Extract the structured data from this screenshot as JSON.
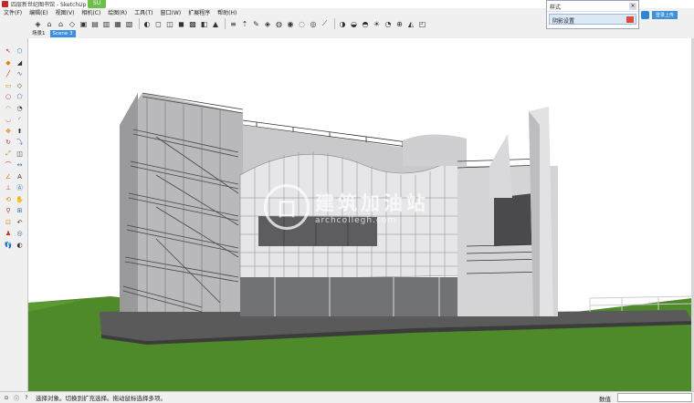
{
  "window": {
    "title": "四层新世纪图书馆 - SketchUp Make",
    "app_badge": "SU"
  },
  "menu": {
    "items": [
      "文件(F)",
      "编辑(E)",
      "视图(V)",
      "相机(C)",
      "绘图(R)",
      "工具(T)",
      "窗口(W)",
      "扩展程序",
      "帮助(H)"
    ]
  },
  "tray": {
    "title": "样式",
    "row_label": "阴影设置"
  },
  "account": {
    "label": "登录上传"
  },
  "scene_tabs": {
    "items": [
      "场景1",
      "Scene 3"
    ],
    "active_index": 1
  },
  "toolbar": {
    "icons": [
      "get-models-icon",
      "component-icon",
      "home-icon",
      "iso-view-icon",
      "top-view-icon",
      "front-view-icon",
      "right-view-icon",
      "back-view-icon",
      "left-view-icon",
      "xray-icon",
      "wireframe-icon",
      "hidden-line-icon",
      "shaded-icon",
      "textured-icon",
      "monochrome-icon",
      "bucket-icon",
      "stairs-icon",
      "walk-icon",
      "pencil-icon",
      "sandbox-icon",
      "smoove-icon",
      "stamp-icon",
      "drape-icon",
      "add-detail-icon",
      "flip-edge-icon",
      "section-plane-icon",
      "section-display-icon",
      "section-cut-icon",
      "shadow-icon",
      "fog-icon",
      "geolocation-icon",
      "terrain-icon",
      "photo-texture-icon"
    ]
  },
  "left_toolbar": {
    "icons": [
      "select-icon",
      "make-component-icon",
      "paint-bucket-icon",
      "eraser-icon",
      "line-icon",
      "freehand-icon",
      "rectangle-icon",
      "rotated-rectangle-icon",
      "circle-icon",
      "polygon-icon",
      "arc-icon",
      "pie-icon",
      "two-point-arc-icon",
      "three-point-arc-icon",
      "move-icon",
      "push-pull-icon",
      "rotate-icon",
      "follow-me-icon",
      "scale-icon",
      "offset-icon",
      "tape-measure-icon",
      "dimension-icon",
      "protractor-icon",
      "text-icon",
      "axes-icon",
      "3d-text-icon",
      "orbit-icon",
      "pan-icon",
      "zoom-icon",
      "zoom-window-icon",
      "zoom-extents-icon",
      "previous-view-icon",
      "position-camera-icon",
      "look-around-icon",
      "walk-tool-icon",
      "section-tool-icon"
    ]
  },
  "watermark": {
    "text": "建筑加油站",
    "url": "archcollegh.com"
  },
  "status": {
    "text": "选择对象。切换到扩充选择。拖动鼠标选择多项。",
    "measure_label": "数值",
    "measure_value": ""
  },
  "colors": {
    "sky": "#ffffff",
    "grass": "#4e8a2a",
    "building_panel": "#e8e8ea",
    "active_tab": "#3a8fe0"
  }
}
